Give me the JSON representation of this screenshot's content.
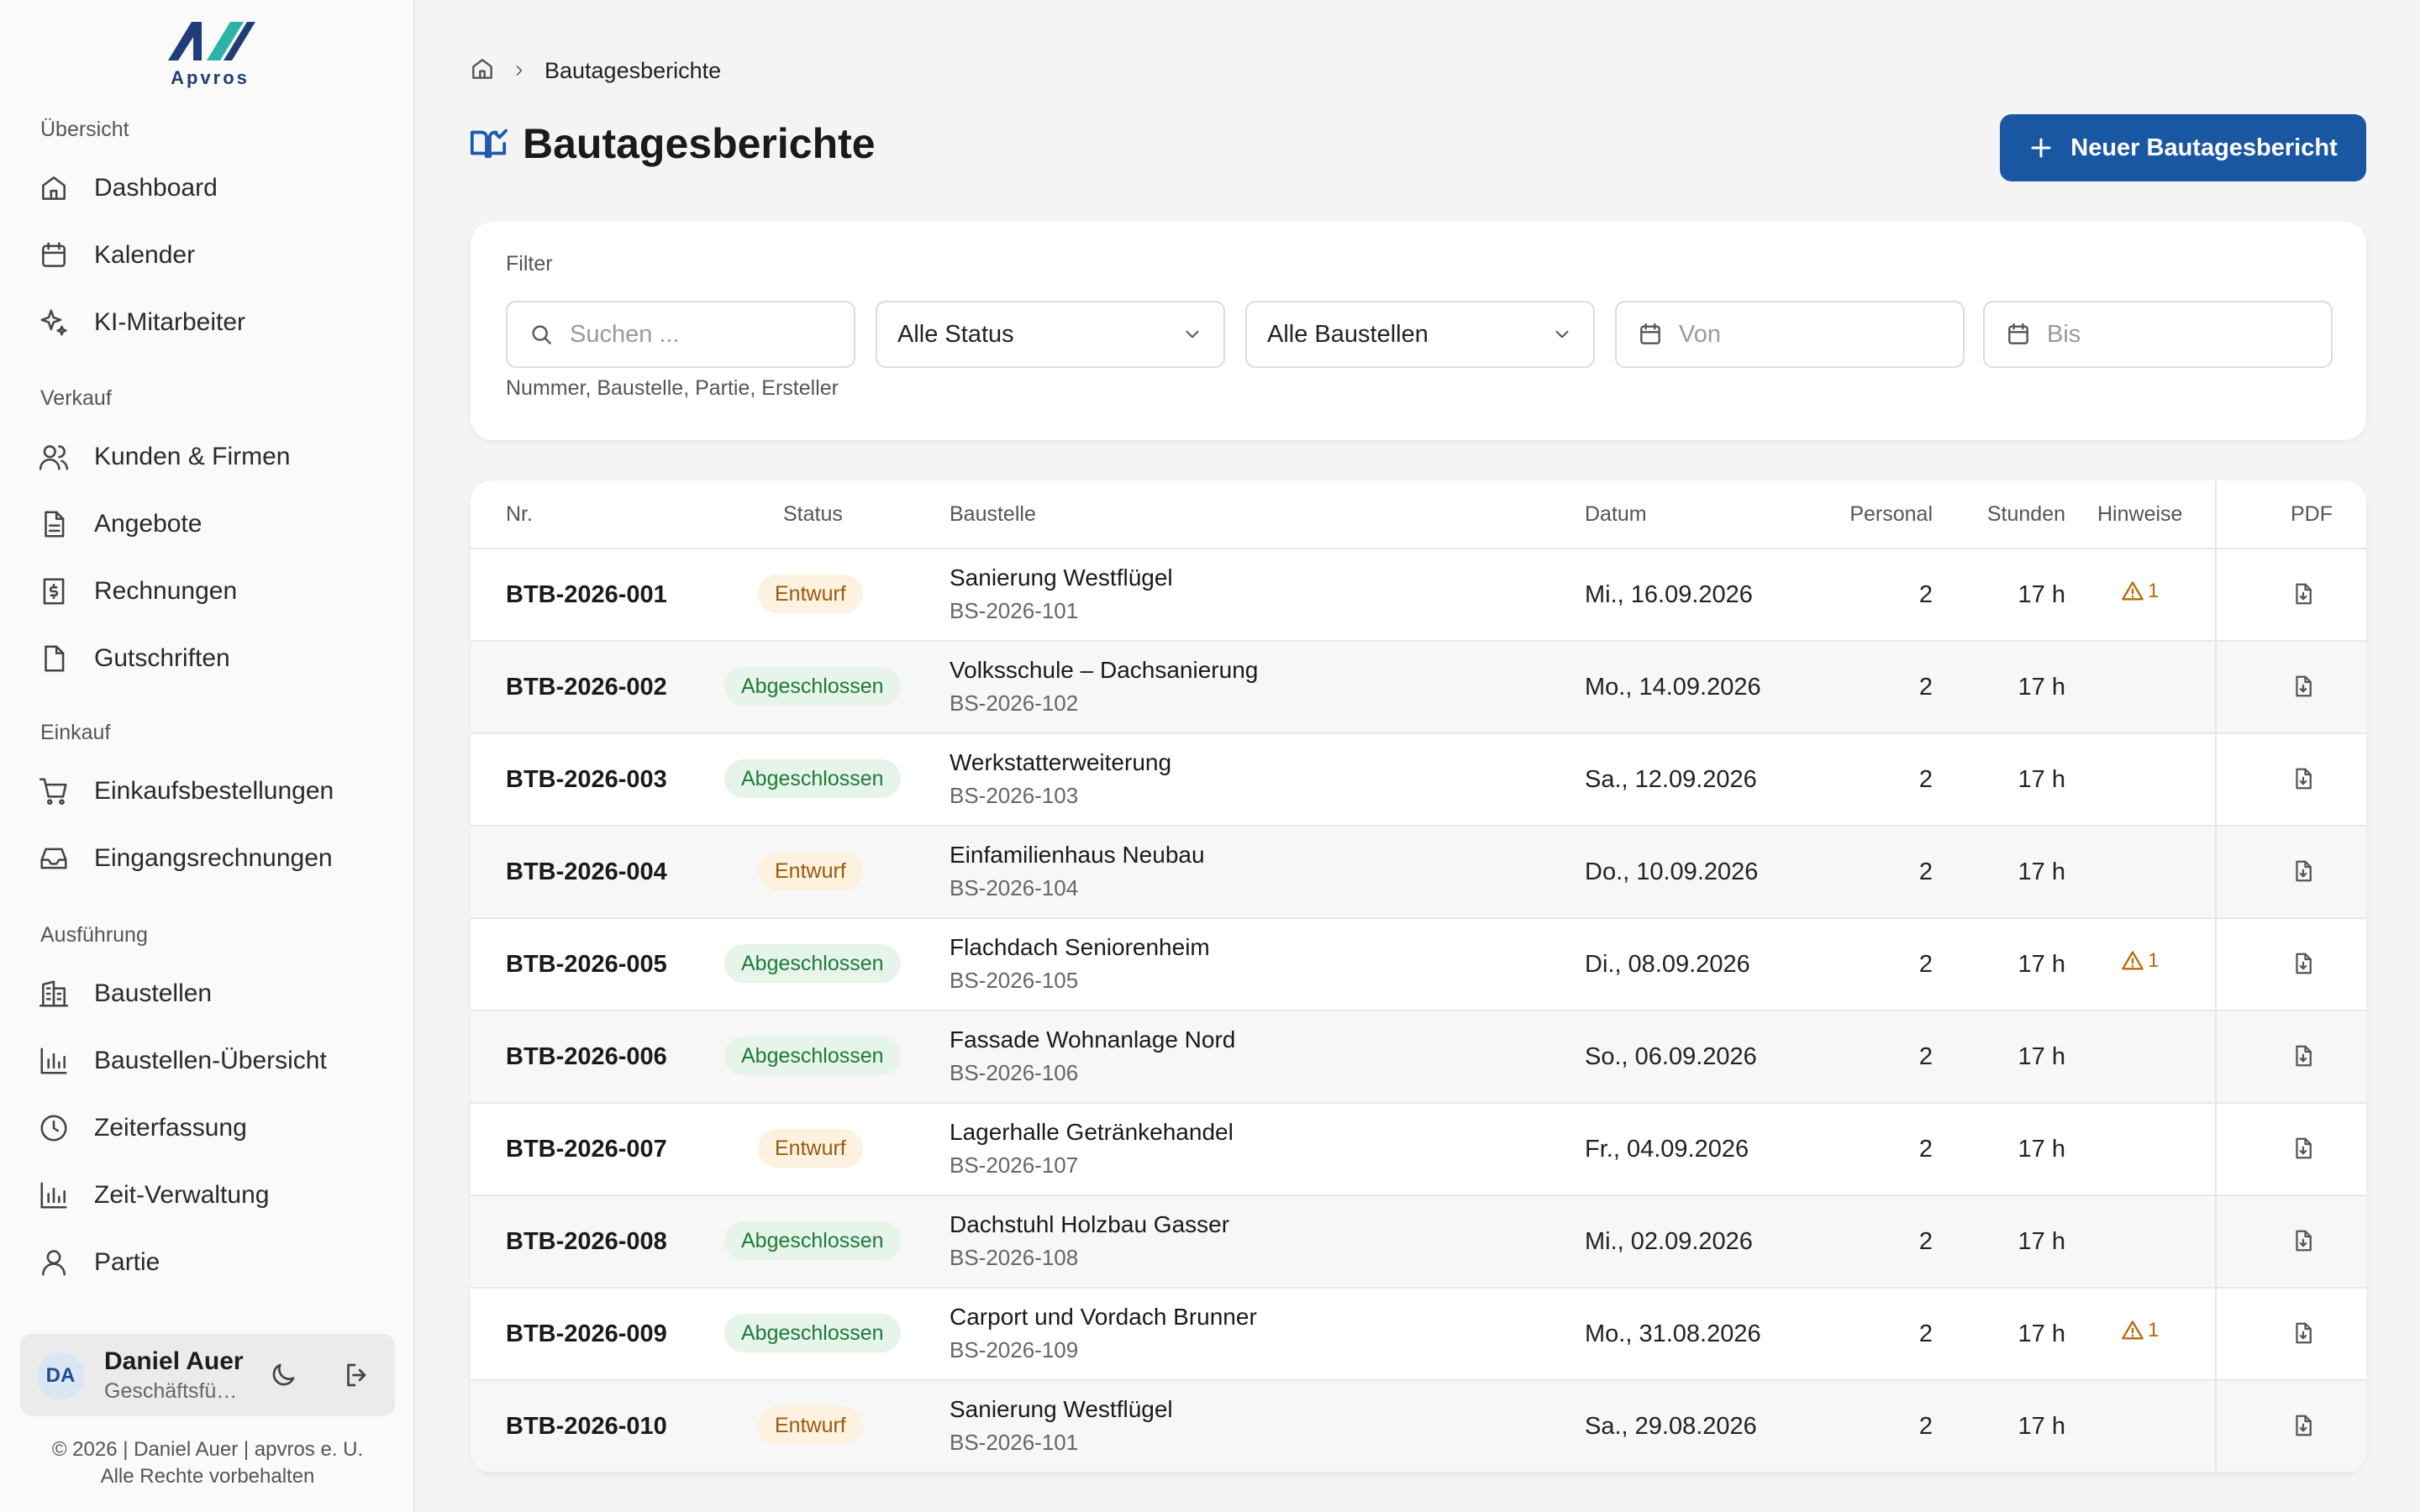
{
  "brand": {
    "name": "Apvros",
    "accent": "#1a57a3"
  },
  "sidebar": {
    "sections": [
      {
        "label": "Übersicht",
        "items": [
          {
            "label": "Dashboard",
            "icon": "home-icon"
          },
          {
            "label": "Kalender",
            "icon": "calendar-icon"
          },
          {
            "label": "KI-Mitarbeiter",
            "icon": "sparkles-icon"
          }
        ]
      },
      {
        "label": "Verkauf",
        "items": [
          {
            "label": "Kunden & Firmen",
            "icon": "users-icon"
          },
          {
            "label": "Angebote",
            "icon": "file-text-icon"
          },
          {
            "label": "Rechnungen",
            "icon": "dollar-file-icon"
          },
          {
            "label": "Gutschriften",
            "icon": "file-icon"
          }
        ]
      },
      {
        "label": "Einkauf",
        "items": [
          {
            "label": "Einkaufsbestellungen",
            "icon": "cart-icon"
          },
          {
            "label": "Eingangsrechnungen",
            "icon": "inbox-icon"
          }
        ]
      },
      {
        "label": "Ausführung",
        "items": [
          {
            "label": "Baustellen",
            "icon": "building-icon"
          },
          {
            "label": "Baustellen-Übersicht",
            "icon": "bar-chart-icon"
          },
          {
            "label": "Zeiterfassung",
            "icon": "clock-icon"
          },
          {
            "label": "Zeit-Verwaltung",
            "icon": "bar-chart-icon"
          },
          {
            "label": "Partie",
            "icon": "user-icon"
          }
        ]
      }
    ]
  },
  "user": {
    "initials": "DA",
    "name": "Daniel Auer",
    "role": "Geschäftsführer"
  },
  "footer": {
    "line1": "© 2026 | Daniel Auer | apvros e. U.",
    "line2": "Alle Rechte vorbehalten"
  },
  "breadcrumb": {
    "current": "Bautagesberichte"
  },
  "page": {
    "title": "Bautagesberichte",
    "new_button": "Neuer Bautagesbericht"
  },
  "filter": {
    "label": "Filter",
    "search_placeholder": "Suchen ...",
    "status_value": "Alle Status",
    "site_value": "Alle Baustellen",
    "from_placeholder": "Von",
    "to_placeholder": "Bis",
    "hint": "Nummer, Baustelle, Partie, Ersteller"
  },
  "table": {
    "columns": {
      "nr": "Nr.",
      "status": "Status",
      "site": "Baustelle",
      "date": "Datum",
      "staff": "Personal",
      "hours": "Stunden",
      "notes": "Hinweise",
      "pdf": "PDF"
    },
    "rows": [
      {
        "nr": "BTB-2026-001",
        "status": "Entwurf",
        "type": "draft",
        "site": "Sanierung Westflügel",
        "code": "BS-2026-101",
        "date": "Mi., 16.09.2026",
        "staff": "2",
        "hours": "17 h",
        "notes": "1"
      },
      {
        "nr": "BTB-2026-002",
        "status": "Abgeschlossen",
        "type": "done",
        "site": "Volksschule – Dachsanierung",
        "code": "BS-2026-102",
        "date": "Mo., 14.09.2026",
        "staff": "2",
        "hours": "17 h",
        "notes": ""
      },
      {
        "nr": "BTB-2026-003",
        "status": "Abgeschlossen",
        "type": "done",
        "site": "Werkstatterweiterung",
        "code": "BS-2026-103",
        "date": "Sa., 12.09.2026",
        "staff": "2",
        "hours": "17 h",
        "notes": ""
      },
      {
        "nr": "BTB-2026-004",
        "status": "Entwurf",
        "type": "draft",
        "site": "Einfamilienhaus Neubau",
        "code": "BS-2026-104",
        "date": "Do., 10.09.2026",
        "staff": "2",
        "hours": "17 h",
        "notes": ""
      },
      {
        "nr": "BTB-2026-005",
        "status": "Abgeschlossen",
        "type": "done",
        "site": "Flachdach Seniorenheim",
        "code": "BS-2026-105",
        "date": "Di., 08.09.2026",
        "staff": "2",
        "hours": "17 h",
        "notes": "1"
      },
      {
        "nr": "BTB-2026-006",
        "status": "Abgeschlossen",
        "type": "done",
        "site": "Fassade Wohnanlage Nord",
        "code": "BS-2026-106",
        "date": "So., 06.09.2026",
        "staff": "2",
        "hours": "17 h",
        "notes": ""
      },
      {
        "nr": "BTB-2026-007",
        "status": "Entwurf",
        "type": "draft",
        "site": "Lagerhalle Getränkehandel",
        "code": "BS-2026-107",
        "date": "Fr., 04.09.2026",
        "staff": "2",
        "hours": "17 h",
        "notes": ""
      },
      {
        "nr": "BTB-2026-008",
        "status": "Abgeschlossen",
        "type": "done",
        "site": "Dachstuhl Holzbau Gasser",
        "code": "BS-2026-108",
        "date": "Mi., 02.09.2026",
        "staff": "2",
        "hours": "17 h",
        "notes": ""
      },
      {
        "nr": "BTB-2026-009",
        "status": "Abgeschlossen",
        "type": "done",
        "site": "Carport und Vordach Brunner",
        "code": "BS-2026-109",
        "date": "Mo., 31.08.2026",
        "staff": "2",
        "hours": "17 h",
        "notes": "1"
      },
      {
        "nr": "BTB-2026-010",
        "status": "Entwurf",
        "type": "draft",
        "site": "Sanierung Westflügel",
        "code": "BS-2026-101",
        "date": "Sa., 29.08.2026",
        "staff": "2",
        "hours": "17 h",
        "notes": ""
      }
    ]
  }
}
